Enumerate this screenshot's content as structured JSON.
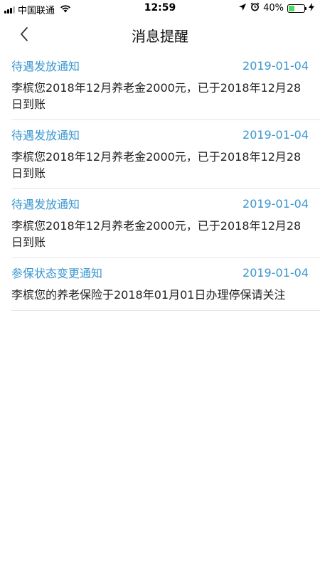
{
  "status_bar": {
    "carrier": "中国联通",
    "time": "12:59",
    "battery": "40%",
    "battery_level": 0.4
  },
  "nav": {
    "title": "消息提醒"
  },
  "messages": [
    {
      "title": "待遇发放通知",
      "date": "2019-01-04",
      "body": "李槟您2018年12月养老金2000元，已于2018年12月28日到账"
    },
    {
      "title": "待遇发放通知",
      "date": "2019-01-04",
      "body": "李槟您2018年12月养老金2000元，已于2018年12月28日到账"
    },
    {
      "title": "待遇发放通知",
      "date": "2019-01-04",
      "body": "李槟您2018年12月养老金2000元，已于2018年12月28日到账"
    },
    {
      "title": "参保状态变更通知",
      "date": "2019-01-04",
      "body": "李槟您的养老保险于2018年01月01日办理停保请关注"
    }
  ]
}
